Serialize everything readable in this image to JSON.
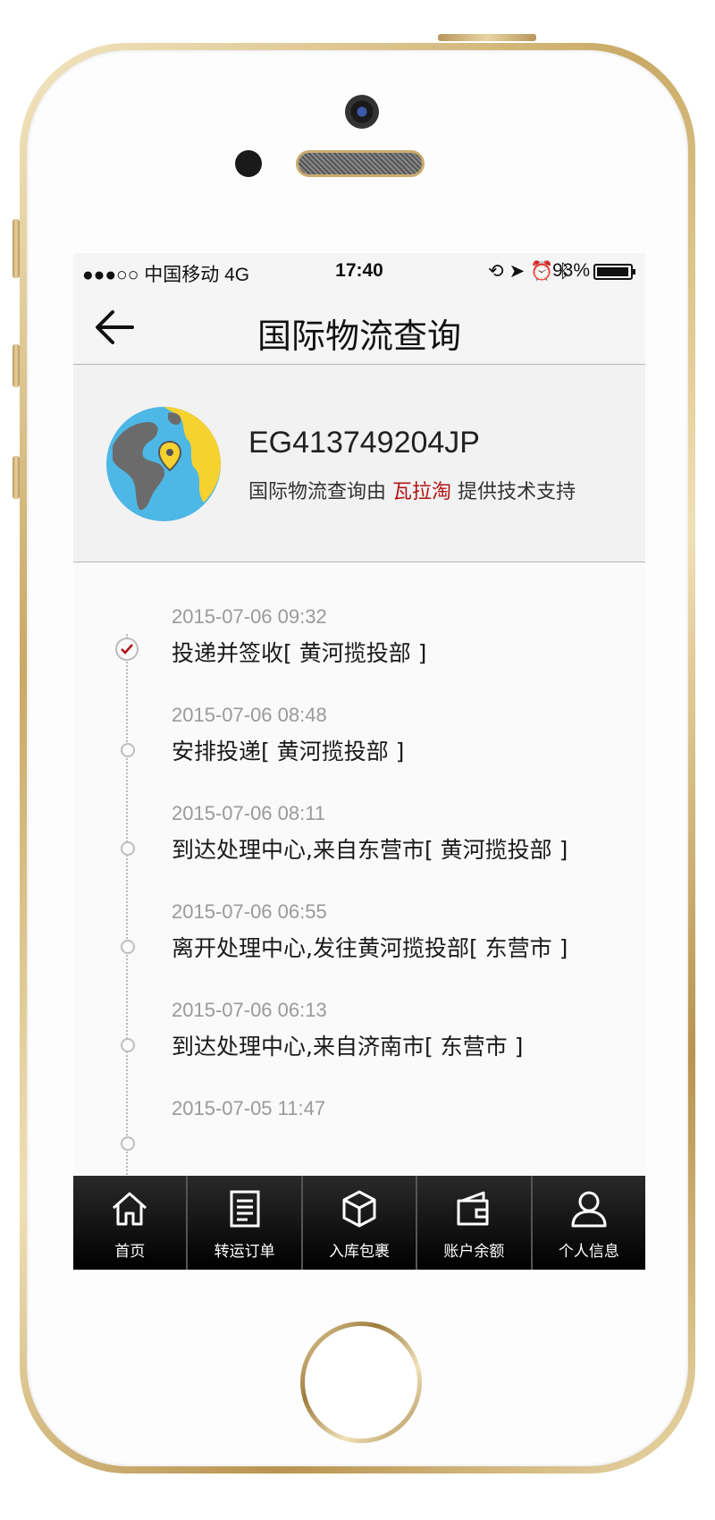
{
  "status_bar": {
    "carrier": "●●●○○ 中国移动 4G",
    "time": "17:40",
    "icons": [
      "lock-rotation-icon",
      "location-arrow-icon",
      "alarm-icon",
      "bluetooth-icon"
    ],
    "battery": "93%"
  },
  "nav": {
    "title": "国际物流查询",
    "back_icon": "back-arrow-icon"
  },
  "package": {
    "tracking_number": "EG413749204JP",
    "provider_prefix": "国际物流查询由",
    "provider_name": "瓦拉淘",
    "provider_suffix": "提供技术支持",
    "globe_icon": "globe-location-icon"
  },
  "events": [
    {
      "time": "2015-07-06 09:32",
      "desc": "投递并签收[ 黄河揽投部 ]",
      "current": true
    },
    {
      "time": "2015-07-06 08:48",
      "desc": "安排投递[ 黄河揽投部 ]",
      "current": false
    },
    {
      "time": "2015-07-06 08:11",
      "desc": "到达处理中心,来自东营市[ 黄河揽投部 ]",
      "current": false
    },
    {
      "time": "2015-07-06 06:55",
      "desc": "离开处理中心,发往黄河揽投部[ 东营市 ]",
      "current": false
    },
    {
      "time": "2015-07-06 06:13",
      "desc": "到达处理中心,来自济南市[ 东营市 ]",
      "current": false
    },
    {
      "time": "2015-07-05 11:47",
      "desc": "",
      "current": false
    }
  ],
  "tabs": [
    {
      "label": "首页",
      "icon": "home-icon"
    },
    {
      "label": "转运订单",
      "icon": "document-icon"
    },
    {
      "label": "入库包裹",
      "icon": "package-box-icon"
    },
    {
      "label": "账户余额",
      "icon": "wallet-icon"
    },
    {
      "label": "个人信息",
      "icon": "person-icon"
    }
  ],
  "colors": {
    "brand_red": "#b01414",
    "tab_bar": "#000000",
    "phone_gold": "#c9a964"
  }
}
